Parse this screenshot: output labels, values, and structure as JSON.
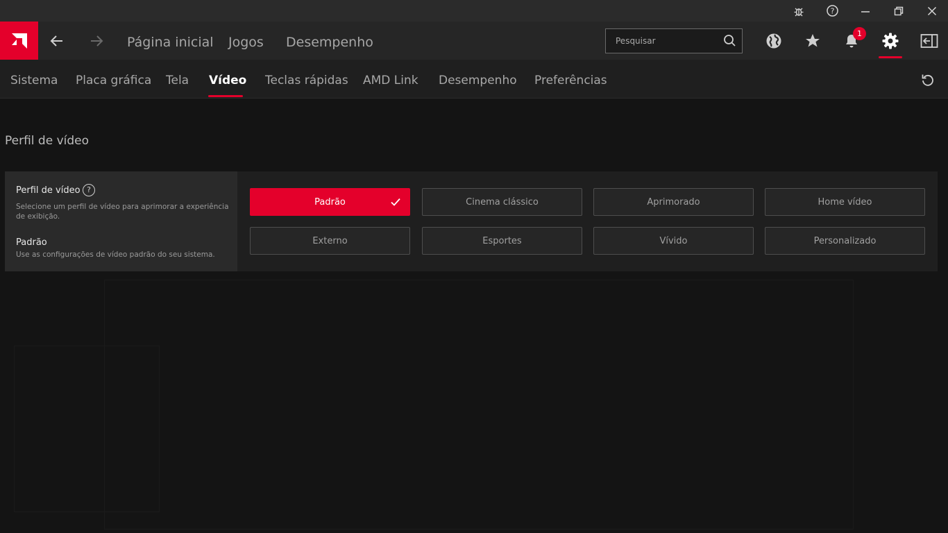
{
  "window": {
    "icons": [
      "bug-icon",
      "help-icon",
      "minimize-icon",
      "restore-icon",
      "close-icon"
    ]
  },
  "topnav": {
    "links": [
      "Página inicial",
      "Jogos",
      "Desempenho"
    ],
    "search_placeholder": "Pesquisar",
    "notification_count": "1"
  },
  "tabs": [
    "Sistema",
    "Placa gráfica",
    "Tela",
    "Vídeo",
    "Teclas rápidas",
    "AMD Link",
    "Desempenho",
    "Preferências"
  ],
  "active_tab": "Vídeo",
  "section": {
    "title": "Perfil de vídeo",
    "setting_title": "Perfil de vídeo",
    "help": "?",
    "setting_desc": "Selecione um perfil de vídeo para aprimorar a experiência de exibição.",
    "selected_title": "Padrão",
    "selected_desc": "Use as configurações de vídeo padrão do seu sistema."
  },
  "profiles": [
    "Padrão",
    "Cinema clássico",
    "Aprimorado",
    "Home vídeo",
    "Externo",
    "Esportes",
    "Vívido",
    "Personalizado"
  ],
  "selected_profile": "Padrão",
  "colors": {
    "accent": "#e4002b"
  }
}
